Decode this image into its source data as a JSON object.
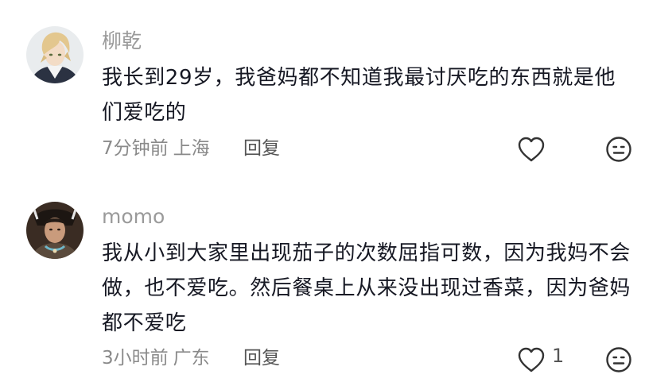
{
  "comments": [
    {
      "username": "柳乾",
      "text": "我长到29岁，我爸妈都不知道我最讨厌吃的东西就是他们爱吃的",
      "time": "7分钟前",
      "location": "上海",
      "reply_label": "回复",
      "like_count": "",
      "like_icon": "heart-outline-icon",
      "dislike_icon": "meh-face-icon"
    },
    {
      "username": "momo",
      "text": "我从小到大家里出现茄子的次数屈指可数，因为我妈不会做，也不爱吃。然后餐桌上从来没出现过香菜，因为爸妈都不爱吃",
      "time": "3小时前",
      "location": "广东",
      "reply_label": "回复",
      "like_count": "1",
      "like_icon": "heart-outline-icon",
      "dislike_icon": "meh-face-icon"
    }
  ],
  "colors": {
    "username": "#9a9a9a",
    "text": "#161823",
    "meta": "#8a8a8a",
    "action": "#555555",
    "icon_stroke": "#333333"
  }
}
